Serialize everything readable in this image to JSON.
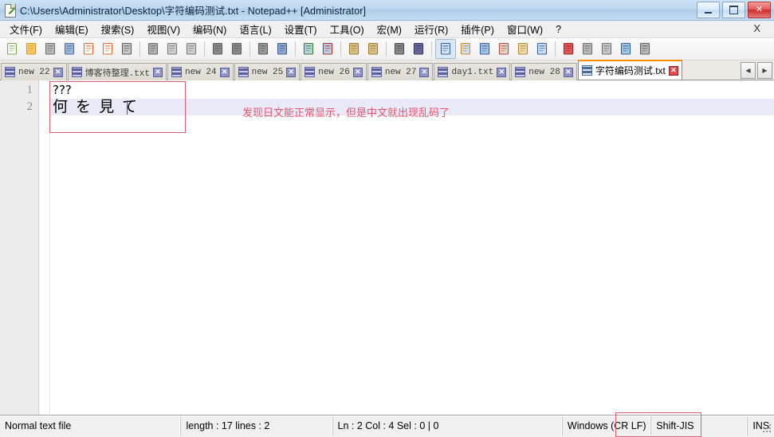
{
  "window": {
    "title": "C:\\Users\\Administrator\\Desktop\\字符编码测试.txt - Notepad++ [Administrator]",
    "icon": "notepad-plus-plus-icon",
    "buttons": {
      "minimize": "minimize-icon",
      "maximize": "maximize-icon",
      "close": "✕"
    }
  },
  "menu": {
    "items": [
      {
        "label": "文件(F)",
        "name": "menu-file"
      },
      {
        "label": "编辑(E)",
        "name": "menu-edit"
      },
      {
        "label": "搜索(S)",
        "name": "menu-search"
      },
      {
        "label": "视图(V)",
        "name": "menu-view"
      },
      {
        "label": "编码(N)",
        "name": "menu-encoding"
      },
      {
        "label": "语言(L)",
        "name": "menu-language"
      },
      {
        "label": "设置(T)",
        "name": "menu-settings"
      },
      {
        "label": "工具(O)",
        "name": "menu-tools"
      },
      {
        "label": "宏(M)",
        "name": "menu-macro"
      },
      {
        "label": "运行(R)",
        "name": "menu-run"
      },
      {
        "label": "插件(P)",
        "name": "menu-plugins"
      },
      {
        "label": "窗口(W)",
        "name": "menu-window"
      },
      {
        "label": "?",
        "name": "menu-help"
      }
    ],
    "close_document": "X"
  },
  "toolbar": {
    "buttons": [
      {
        "name": "new-file-icon",
        "group": 1
      },
      {
        "name": "open-file-icon",
        "group": 1
      },
      {
        "name": "save-icon",
        "group": 1
      },
      {
        "name": "save-all-icon",
        "group": 1
      },
      {
        "name": "close-file-icon",
        "group": 1
      },
      {
        "name": "close-all-icon",
        "group": 1
      },
      {
        "name": "print-icon",
        "group": 1
      },
      {
        "name": "cut-icon",
        "group": 2
      },
      {
        "name": "copy-icon",
        "group": 2
      },
      {
        "name": "paste-icon",
        "group": 2
      },
      {
        "name": "undo-icon",
        "group": 3
      },
      {
        "name": "redo-icon",
        "group": 3
      },
      {
        "name": "find-icon",
        "group": 4
      },
      {
        "name": "replace-icon",
        "group": 4
      },
      {
        "name": "zoom-in-icon",
        "group": 5
      },
      {
        "name": "zoom-out-icon",
        "group": 5
      },
      {
        "name": "sync-vertical-scroll-icon",
        "group": 6
      },
      {
        "name": "sync-horizontal-scroll-icon",
        "group": 6
      },
      {
        "name": "word-wrap-icon",
        "group": 7
      },
      {
        "name": "show-all-characters-icon",
        "group": 7
      },
      {
        "name": "indent-guide-icon",
        "group": 8
      },
      {
        "name": "user-defined-dialog-icon",
        "group": 8
      },
      {
        "name": "document-map-icon",
        "group": 8
      },
      {
        "name": "function-list-icon",
        "group": 8
      },
      {
        "name": "folder-as-workspace-icon",
        "group": 8
      },
      {
        "name": "monitoring-icon",
        "group": 8
      },
      {
        "name": "record-macro-icon",
        "group": 9
      },
      {
        "name": "stop-recording-icon",
        "group": 9
      },
      {
        "name": "play-macro-icon",
        "group": 9
      },
      {
        "name": "run-macro-multiple-icon",
        "group": 9
      },
      {
        "name": "save-macro-icon",
        "group": 9
      }
    ]
  },
  "tabs": {
    "items": [
      {
        "label": "new  22",
        "active": false
      },
      {
        "label": "博客待整理.txt",
        "active": false
      },
      {
        "label": "new  24",
        "active": false
      },
      {
        "label": "new  25",
        "active": false
      },
      {
        "label": "new  26",
        "active": false
      },
      {
        "label": "new  27",
        "active": false
      },
      {
        "label": "day1.txt",
        "active": false
      },
      {
        "label": "new  28",
        "active": false
      },
      {
        "label": "字符编码测试.txt",
        "active": true
      }
    ],
    "scroll_left": "◀",
    "scroll_right": "▶"
  },
  "editor": {
    "lines": [
      {
        "number": "1",
        "text": "???",
        "current": false
      },
      {
        "number": "2",
        "text": "何 を 見 て",
        "current": true
      }
    ],
    "annotation": "发现日文能正常显示，但是中文就出现乱码了",
    "annotation_color": "#e8546a",
    "caret_line": 2,
    "current_line_color": "#e9e9f7"
  },
  "statusbar": {
    "file_type": "Normal text file",
    "length_lines": "length : 17    lines : 2",
    "position": "Ln : 2    Col : 4    Sel : 0 | 0",
    "eol": "Windows (CR LF)",
    "encoding": "Shift-JIS",
    "insert_mode": "INS"
  }
}
